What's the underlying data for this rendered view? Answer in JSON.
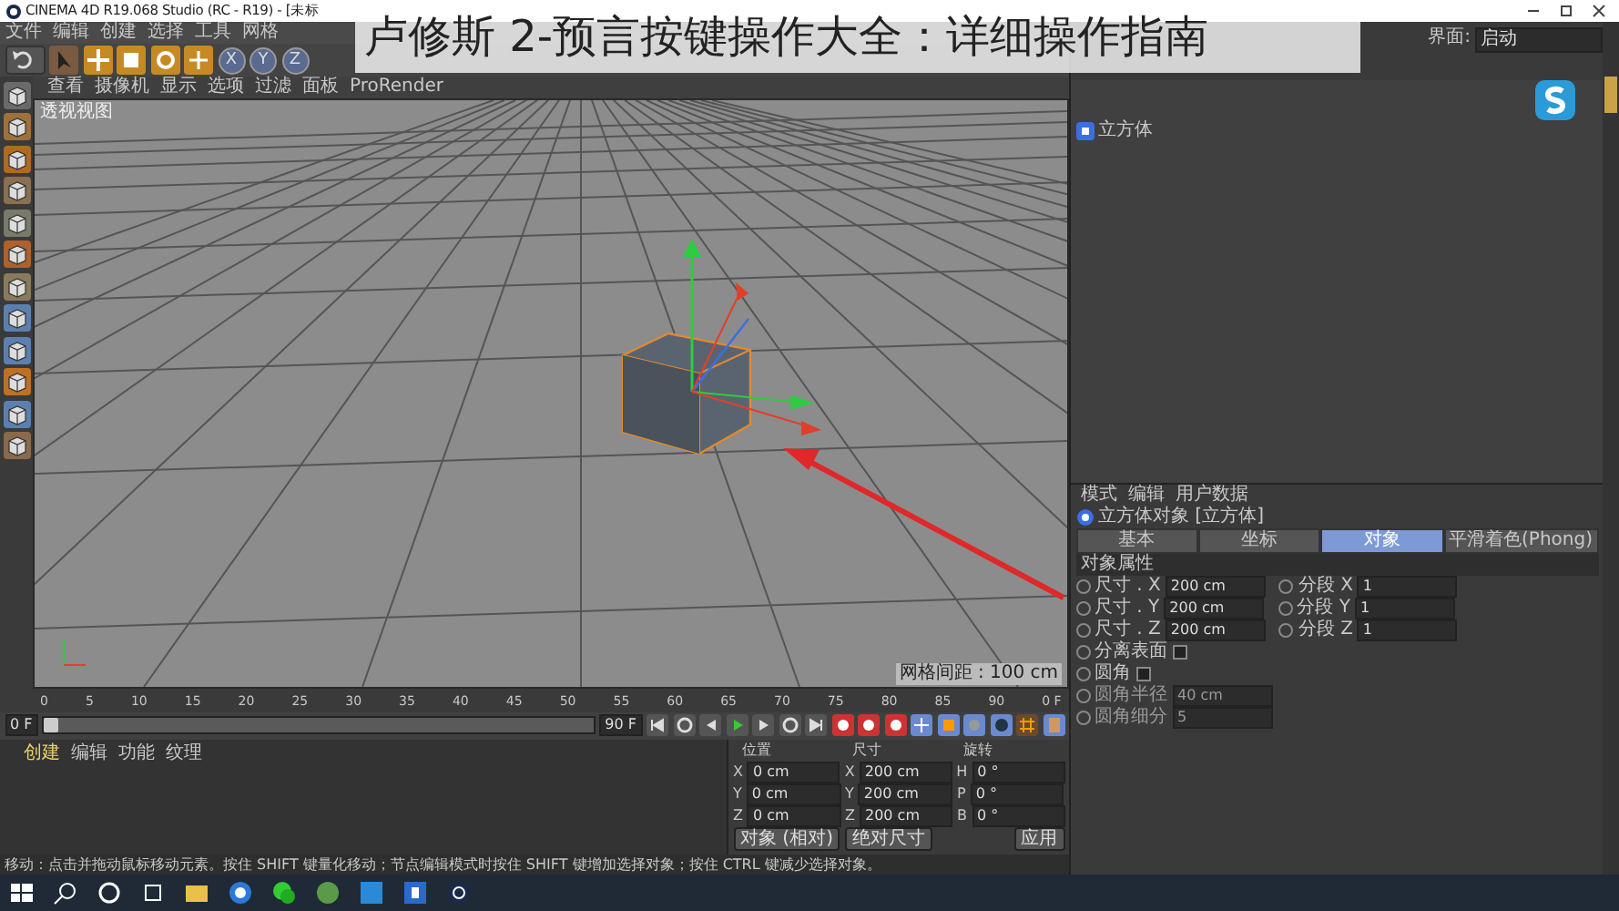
{
  "window": {
    "title": "CINEMA 4D R19.068 Studio (RC - R19) - [未标"
  },
  "overlay_title": "卢修斯 2-预言按键操作大全：详细操作指南",
  "menu": [
    "文件",
    "编辑",
    "创建",
    "选择",
    "工具",
    "网格"
  ],
  "axis_buttons": [
    "X",
    "Y",
    "Z"
  ],
  "layout": {
    "label": "界面:",
    "value": "启动"
  },
  "viewport": {
    "menu": [
      "查看",
      "摄像机",
      "显示",
      "选项",
      "过滤",
      "面板",
      "ProRender"
    ],
    "label": "透视视图",
    "grid_info": "网格间距 : 100 cm"
  },
  "timeline": {
    "ticks": [
      "0",
      "5",
      "10",
      "15",
      "20",
      "25",
      "30",
      "35",
      "40",
      "45",
      "50",
      "55",
      "60",
      "65",
      "70",
      "75",
      "80",
      "85",
      "90"
    ],
    "end_marker": "0 F",
    "start": "0 F",
    "end": "90 F",
    "level": 0
  },
  "materials": {
    "tabs": [
      {
        "label": "创建",
        "selected": true
      },
      {
        "label": "编辑",
        "selected": false
      },
      {
        "label": "功能",
        "selected": false
      },
      {
        "label": "纹理",
        "selected": false
      }
    ]
  },
  "coordinates": {
    "headers": [
      "位置",
      "尺寸",
      "旋转"
    ],
    "rows": [
      {
        "axis": "X",
        "position": "0 cm",
        "size_axis": "X",
        "size": "200 cm",
        "rot_axis": "H",
        "rotation": "0 °"
      },
      {
        "axis": "Y",
        "position": "0 cm",
        "size_axis": "Y",
        "size": "200 cm",
        "rot_axis": "P",
        "rotation": "0 °"
      },
      {
        "axis": "Z",
        "position": "0 cm",
        "size_axis": "Z",
        "size": "200 cm",
        "rot_axis": "B",
        "rotation": "0 °"
      }
    ],
    "mode": "对象 (相对)",
    "size_mode": "绝对尺寸",
    "apply": "应用"
  },
  "objects": [
    {
      "name": "立方体"
    }
  ],
  "attributes": {
    "menu": [
      "模式",
      "编辑",
      "用户数据"
    ],
    "object_title": "立方体对象 [立方体]",
    "tabs": [
      {
        "label": "基本",
        "selected": false
      },
      {
        "label": "坐标",
        "selected": false
      },
      {
        "label": "对象",
        "selected": true
      },
      {
        "label": "平滑着色(Phong)",
        "selected": false
      }
    ],
    "section": "对象属性",
    "params": [
      {
        "label": "尺寸 . X",
        "value": "200 cm",
        "seg_label": "分段 X",
        "seg_value": "1"
      },
      {
        "label": "尺寸 . Y",
        "value": "200 cm",
        "seg_label": "分段 Y",
        "seg_value": "1"
      },
      {
        "label": "尺寸 . Z",
        "value": "200 cm",
        "seg_label": "分段 Z",
        "seg_value": "1"
      }
    ],
    "options": [
      {
        "kind": "check",
        "label": "分离表面",
        "checked": false,
        "disabled": false
      },
      {
        "kind": "check",
        "label": "圆角",
        "checked": false,
        "disabled": false
      },
      {
        "kind": "field",
        "label": "圆角半径",
        "value": "40 cm",
        "disabled": true
      },
      {
        "kind": "field",
        "label": "圆角细分",
        "value": "5",
        "disabled": true
      }
    ]
  },
  "status_bar": "移动：点击并拖动鼠标移动元素。按住 SHIFT 键量化移动；节点编辑模式时按住 SHIFT 键增加选择对象；按住 CTRL 键减少选择对象。"
}
